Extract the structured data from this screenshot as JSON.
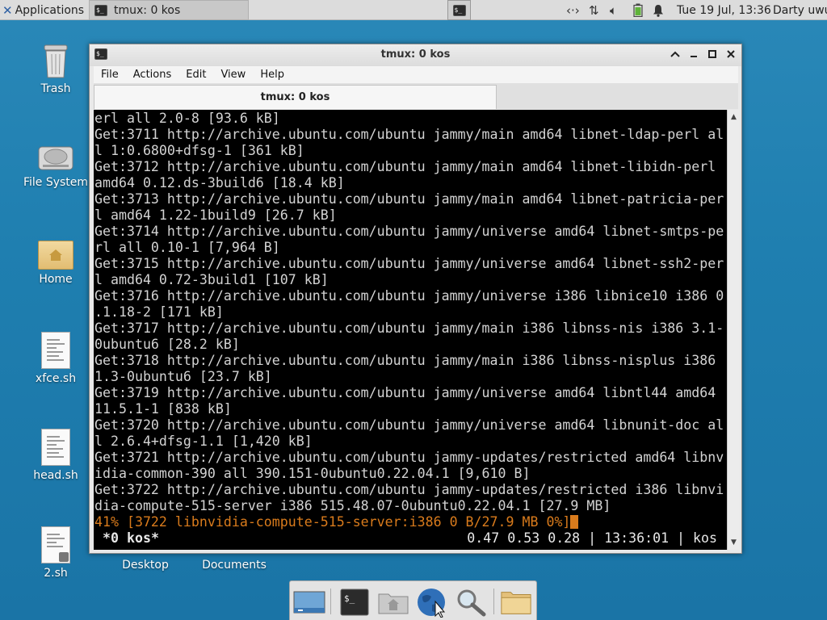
{
  "top_panel": {
    "applications_label": "Applications",
    "task_label": "tmux: 0 kos",
    "clock": "Tue 19 Jul, 13:36",
    "user": "Darty uwu"
  },
  "desktop": {
    "icons": [
      {
        "label": "Trash"
      },
      {
        "label": "File System"
      },
      {
        "label": "Home"
      },
      {
        "label": "xfce.sh"
      },
      {
        "label": "head.sh"
      },
      {
        "label": "2.sh"
      },
      {
        "label": "Desktop"
      },
      {
        "label": "Documents"
      }
    ]
  },
  "window": {
    "title": "tmux: 0 kos",
    "menu": [
      "File",
      "Actions",
      "Edit",
      "View",
      "Help"
    ],
    "tab_label": "tmux: 0 kos"
  },
  "terminal": {
    "lines": [
      "erl all 2.0-8 [93.6 kB]",
      "Get:3711 http://archive.ubuntu.com/ubuntu jammy/main amd64 libnet-ldap-perl al",
      "l 1:0.6800+dfsg-1 [361 kB]",
      "Get:3712 http://archive.ubuntu.com/ubuntu jammy/main amd64 libnet-libidn-perl",
      "amd64 0.12.ds-3build6 [18.4 kB]",
      "Get:3713 http://archive.ubuntu.com/ubuntu jammy/main amd64 libnet-patricia-per",
      "l amd64 1.22-1build9 [26.7 kB]",
      "Get:3714 http://archive.ubuntu.com/ubuntu jammy/universe amd64 libnet-smtps-pe",
      "rl all 0.10-1 [7,964 B]",
      "Get:3715 http://archive.ubuntu.com/ubuntu jammy/universe amd64 libnet-ssh2-per",
      "l amd64 0.72-3build1 [107 kB]",
      "Get:3716 http://archive.ubuntu.com/ubuntu jammy/universe i386 libnice10 i386 0",
      ".1.18-2 [171 kB]",
      "Get:3717 http://archive.ubuntu.com/ubuntu jammy/main i386 libnss-nis i386 3.1-",
      "0ubuntu6 [28.2 kB]",
      "Get:3718 http://archive.ubuntu.com/ubuntu jammy/main i386 libnss-nisplus i386",
      "1.3-0ubuntu6 [23.7 kB]",
      "Get:3719 http://archive.ubuntu.com/ubuntu jammy/universe amd64 libntl44 amd64",
      "11.5.1-1 [838 kB]",
      "Get:3720 http://archive.ubuntu.com/ubuntu jammy/universe amd64 libnunit-doc al",
      "l 2.6.4+dfsg-1.1 [1,420 kB]",
      "Get:3721 http://archive.ubuntu.com/ubuntu jammy-updates/restricted amd64 libnv",
      "idia-common-390 all 390.151-0ubuntu0.22.04.1 [9,610 B]",
      "Get:3722 http://archive.ubuntu.com/ubuntu jammy-updates/restricted i386 libnvi",
      "dia-compute-515-server i386 515.48.07-0ubuntu0.22.04.1 [27.9 MB]"
    ],
    "progress_line": "41% [3722 libnvidia-compute-515-server:i386 0 B/27.9 MB 0%]",
    "status_left": "*0 kos*",
    "status_right": "0.47 0.53 0.28 | 13:36:01 | kos"
  },
  "colors": {
    "desktop_background": "#1f7fb0",
    "terminal_background": "#000000",
    "terminal_text": "#d3d3d3",
    "progress_accent": "#d97b1c"
  },
  "icons": {
    "panel": [
      "xfce-logo-icon",
      "terminal-icon",
      "network-icon",
      "transfer-icon",
      "volume-icon",
      "battery-icon",
      "notification-bell-icon"
    ],
    "dock": [
      "show-desktop-icon",
      "terminal-icon",
      "file-manager-icon",
      "web-browser-icon",
      "search-icon",
      "folder-icon"
    ]
  }
}
